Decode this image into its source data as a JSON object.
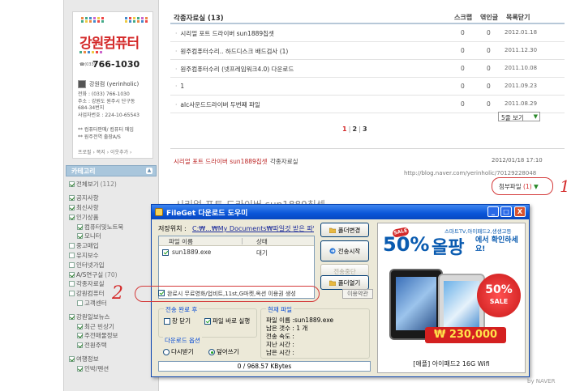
{
  "sidebar": {
    "logo_title": "강원컴퓨터",
    "logo_phone_prefix": "☎(033)",
    "logo_phone": "766-1030",
    "owner": "강원컴 (yerinholic)",
    "info_lines": [
      "전화 : (033) 766-1030",
      "주소 : 강원도 원주시 단구동",
      "       684-34번지",
      "사업자번호 : 224-10-65543"
    ],
    "link_lines": [
      "** 컴퓨터판매/ 컴퓨터 매입",
      "** 원주전역 출장A/S"
    ],
    "profile_menu": "프로필 › 쪽지 › 이웃추가 ›",
    "category_header": "카테고리",
    "category_toggle": "▲",
    "categories": [
      {
        "label": "전체보기",
        "count": "(112)",
        "checked": true,
        "sub": false
      },
      {
        "label": "공지사항",
        "count": "",
        "checked": true,
        "sub": false
      },
      {
        "label": "최신사항",
        "count": "",
        "checked": true,
        "sub": false
      },
      {
        "label": "인기상품",
        "count": "",
        "checked": true,
        "sub": false
      },
      {
        "label": "컴퓨터및노트북",
        "count": "",
        "checked": true,
        "sub": true
      },
      {
        "label": "모니터",
        "count": "",
        "checked": true,
        "sub": true
      },
      {
        "label": "중고매입",
        "count": "",
        "checked": false,
        "sub": false
      },
      {
        "label": "유지보수",
        "count": "",
        "checked": false,
        "sub": false
      },
      {
        "label": "인터넷가입",
        "count": "",
        "checked": false,
        "sub": false
      },
      {
        "label": "A/S연구실",
        "count": "(70)",
        "checked": true,
        "sub": false
      },
      {
        "label": "각종자료실",
        "count": "",
        "checked": false,
        "sub": false
      },
      {
        "label": "강원컴퓨터",
        "count": "",
        "checked": false,
        "sub": false
      },
      {
        "label": "고객센터",
        "count": "",
        "checked": false,
        "sub": true
      },
      {
        "label": "강원일보뉴스",
        "count": "",
        "checked": true,
        "sub": false
      },
      {
        "label": "최근 빈상기",
        "count": "",
        "checked": true,
        "sub": true
      },
      {
        "label": "주전매물정보",
        "count": "",
        "checked": true,
        "sub": true
      },
      {
        "label": "전원주택",
        "count": "",
        "checked": true,
        "sub": true
      },
      {
        "label": "여행정보",
        "count": "",
        "checked": true,
        "sub": false
      },
      {
        "label": "인박/펜션",
        "count": "",
        "checked": true,
        "sub": true
      }
    ]
  },
  "list": {
    "title": "각종자료실 (13)",
    "columns": [
      "스크랩",
      "엮인글",
      "목록닫기"
    ],
    "rows": [
      {
        "title": "시리얼 포트 드라이버 sun1889칩셋",
        "scrap": "0",
        "link": "0",
        "date": "2012.01.18"
      },
      {
        "title": "원주컴퓨터수리.. 하드디스크 배드검사 (1)",
        "scrap": "0",
        "link": "0",
        "date": "2011.12.30"
      },
      {
        "title": "원주컴퓨터수리 (넷프레임워크4.0) 다운로드",
        "scrap": "0",
        "link": "0",
        "date": "2011.10.08"
      },
      {
        "title": "1",
        "scrap": "0",
        "link": "0",
        "date": "2011.09.23"
      },
      {
        "title": "alc사운드드라이버 두번째 파일",
        "scrap": "0",
        "link": "0",
        "date": "2011.08.29"
      }
    ],
    "view_select": "5줄 보기",
    "view_arrow": "▼",
    "pages": [
      "1",
      "2",
      "3"
    ]
  },
  "post": {
    "link_title": "시리얼 포트 드라이버 sun1889칩셋",
    "category": "각종자료실",
    "date": "2012/01/18 17:10",
    "url": "http://blog.naver.com/yerinholic/70129228048",
    "attach_label": "첨부파일",
    "attach_count": "(1)",
    "attach_arrow": "▼",
    "heading": "시리얼 포트 드라이버 sun1889칩셋",
    "footer": "by NAVER"
  },
  "dialog": {
    "title": "FileGet 다운로드 도우미",
    "minimize": "_",
    "maximize": "□",
    "close": "X",
    "save_label": "저장위치 :",
    "save_path": "C:₩...₩My Documents₩파일것 받은 파일₩",
    "file_head_name": "파일 이름",
    "file_head_state": "상태",
    "file_name": "sun1889.exe",
    "file_state": "대기",
    "btn_change": "폴더변경",
    "btn_start": "전송시작",
    "btn_stop": "전송중단",
    "btn_open": "폴더열기",
    "promo_text": "완료시 무료영화/업비트,11st,G마켓,옥션 이용권 생성",
    "terms": "이용약관",
    "after_title": "전송 완료 후",
    "opt_close": "창 닫기",
    "opt_run": "파일 바로 실행",
    "download_title": "다운로드 옵션",
    "opt_redownload": "다시받기",
    "opt_overwrite": "덮어쓰기",
    "current_title": "현재 파일",
    "stats": [
      "파일 이름 :sun1889.exe",
      "남은 갯수 : 1 개",
      "전송 속도 :",
      "지난 시간 :",
      "남은 시간 :"
    ],
    "progress": "0  /  968.57 KBytes"
  },
  "ad": {
    "top": "스마트TV,아이패드2,생생고등",
    "sale_tag": "SALE",
    "pct": "50%",
    "olpang": "올팡",
    "sub": "에서 확인하세요!",
    "badge_pct": "50%",
    "badge_sale": "SALE",
    "price": "₩ 230,000",
    "bottom": "[애플] 아이패드2 16G Wifi"
  },
  "annotations": {
    "mark_1": "1",
    "mark_2": "2"
  },
  "colors": {
    "accent_red": "#d42a2a",
    "xp_title": "#0a55d8",
    "category_bar": "#a9c6dc"
  }
}
